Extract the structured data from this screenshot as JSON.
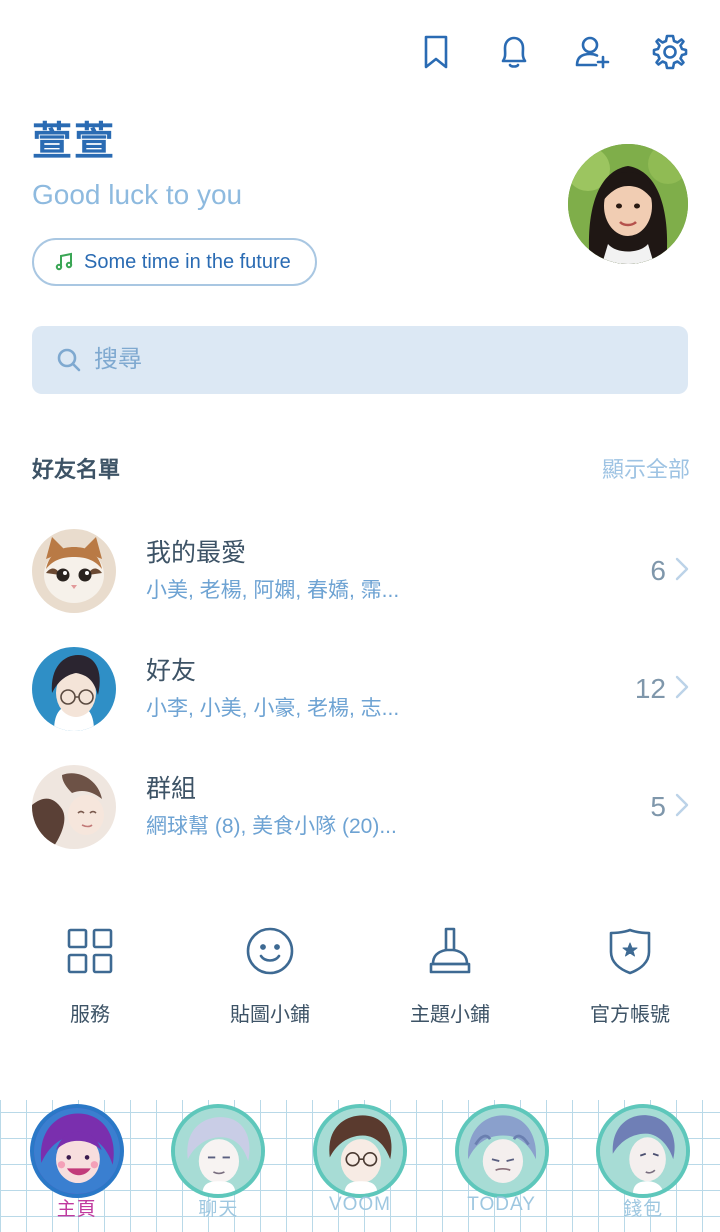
{
  "profile": {
    "name": "萱萱",
    "status": "Good luck to you",
    "music": "Some time in the future"
  },
  "search": {
    "placeholder": "搜尋"
  },
  "friends_section": {
    "title": "好友名單",
    "show_all": "顯示全部",
    "groups": [
      {
        "title": "我的最愛",
        "members": "小美, 老楊, 阿嫻, 春嬌, 霈...",
        "count": "6",
        "thumb": "cat"
      },
      {
        "title": "好友",
        "members": "小李, 小美, 小豪, 老楊, 志...",
        "count": "12",
        "thumb": "anime-glasses"
      },
      {
        "title": "群組",
        "members": "網球幫 (8), 美食小隊 (20)...",
        "count": "5",
        "thumb": "anime-sketch"
      }
    ]
  },
  "quick_actions": [
    {
      "label": "服務",
      "icon": "grid-icon"
    },
    {
      "label": "貼圖小鋪",
      "icon": "smiley-icon"
    },
    {
      "label": "主題小鋪",
      "icon": "brush-icon"
    },
    {
      "label": "官方帳號",
      "icon": "shield-star-icon"
    }
  ],
  "bottom_nav": [
    {
      "label": "主頁",
      "active": true
    },
    {
      "label": "聊天",
      "active": false
    },
    {
      "label": "VOOM",
      "active": false
    },
    {
      "label": "TODAY",
      "active": false
    },
    {
      "label": "錢包",
      "active": false
    }
  ],
  "colors": {
    "accent": "#2a6bb3",
    "search_bg": "#dce8f4",
    "active_tab_label": "#c03a9f",
    "inactive_tab_label": "#9ec7e0",
    "nav_ring": "#5ec7bb"
  }
}
